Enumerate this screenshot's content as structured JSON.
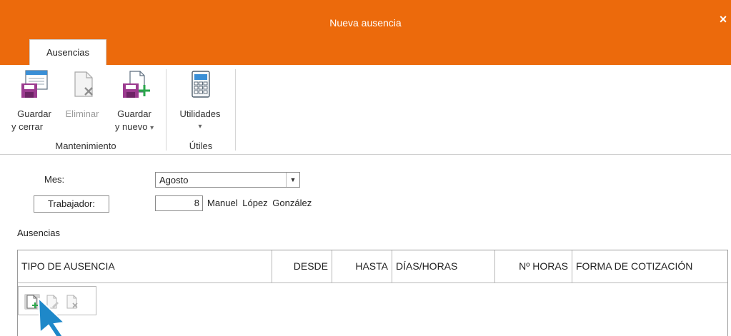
{
  "window": {
    "title": "Nueva ausencia",
    "close_glyph": "×"
  },
  "ribbon": {
    "tab": "Ausencias",
    "buttons": {
      "save_close": {
        "line1": "Guardar",
        "line2": "y cerrar",
        "icon": "save-close-icon"
      },
      "delete": {
        "line1": "Eliminar",
        "icon": "delete-doc-icon"
      },
      "save_new": {
        "line1": "Guardar",
        "line2": "y nuevo",
        "arrow": "▾",
        "icon": "save-new-icon"
      },
      "utilities": {
        "line1": "Utilidades",
        "arrow": "▾",
        "icon": "calculator-icon"
      }
    },
    "groups": {
      "maintenance": "Mantenimiento",
      "tools": "Útiles"
    }
  },
  "form": {
    "month_label": "Mes:",
    "month_value": "Agosto",
    "dropdown_glyph": "▼",
    "worker_button": "Trabajador:",
    "worker_number": "8",
    "worker_name": "Manuel López González",
    "absences_label": "Ausencias"
  },
  "grid": {
    "columns": [
      "TIPO DE AUSENCIA",
      "DESDE",
      "HASTA",
      "DÍAS/HORAS",
      "Nº HORAS",
      "FORMA DE COTIZACIÓN"
    ],
    "toolbar": [
      "new-row-icon",
      "edit-row-icon",
      "delete-row-icon"
    ]
  },
  "colors": {
    "accent": "#ec6a0c",
    "icon_purple": "#9b3b8f",
    "icon_green": "#2aa64b",
    "cursor": "#1e88c9"
  }
}
